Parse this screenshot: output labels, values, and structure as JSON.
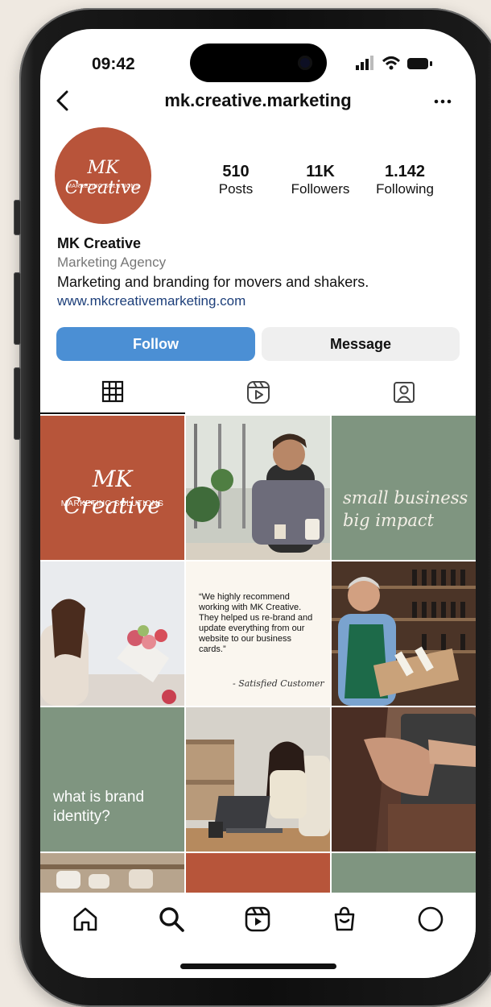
{
  "status_bar": {
    "time": "09:42"
  },
  "header": {
    "handle": "mk.creative.marketing"
  },
  "profile": {
    "avatar_script": "MK Creative",
    "avatar_tagline": "MARKETING SOLUTIONS",
    "stats": [
      {
        "value": "510",
        "label": "Posts"
      },
      {
        "value": "11K",
        "label": "Followers"
      },
      {
        "value": "1.142",
        "label": "Following"
      }
    ],
    "name": "MK Creative",
    "category": "Marketing Agency",
    "bio": "Marketing and branding for movers and shakers.",
    "website": "www.mkcreativemarketing.com"
  },
  "actions": {
    "follow": "Follow",
    "message": "Message"
  },
  "tabs": [
    "grid-icon",
    "reels-icon",
    "tagged-icon"
  ],
  "posts": {
    "p1_script": "MK Creative",
    "p1_small": "MARKETING SOLUTIONS",
    "p3_line1": "small business",
    "p3_line2": "big impact",
    "p5_quote": "“We highly recommend working with MK Creative. They helped us re-brand and update everything from our website to our business cards.”",
    "p5_sig": "- Satisfied Customer",
    "p7_text": "what is brand identity?"
  },
  "nav": [
    "home-icon",
    "search-icon",
    "reels-icon",
    "shop-icon",
    "profile-icon"
  ],
  "colors": {
    "rust": "#b7553a",
    "sage": "#7f9580",
    "follow_blue": "#4b8fd4",
    "link": "#1d3f7a"
  }
}
